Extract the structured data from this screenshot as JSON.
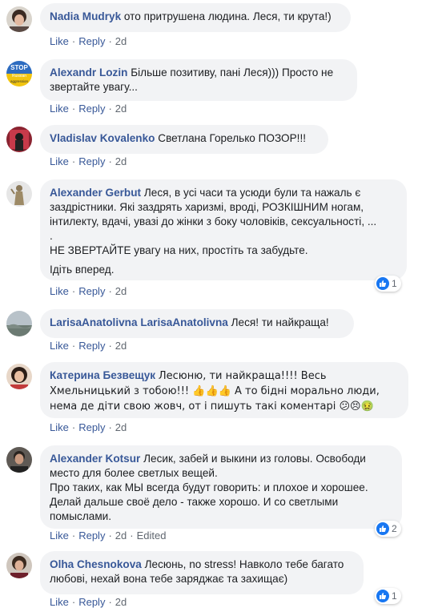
{
  "comments": [
    {
      "author": "Nadia Mudryk",
      "paragraphs": [
        "ото притрушена людина. Леся, ти крута!)"
      ],
      "actions": {
        "like": "Like",
        "reply": "Reply",
        "time": "2d"
      }
    },
    {
      "author": "Alexandr Lozin",
      "paragraphs": [
        "Більше позитиву, пані Леся))) Просто не звертайте увагу..."
      ],
      "avatar_text": {
        "line1": "STOP",
        "line2": "Russian",
        "line3": "aggression"
      },
      "actions": {
        "like": "Like",
        "reply": "Reply",
        "time": "2d"
      }
    },
    {
      "author": "Vladislav Kovalenko",
      "paragraphs": [
        "Светлана Горелько ПОЗОР!!!"
      ],
      "actions": {
        "like": "Like",
        "reply": "Reply",
        "time": "2d"
      }
    },
    {
      "author": "Alexander Gerbut",
      "paragraphs": [
        "Леся, в усі часи та усюди були та нажаль є заздрістники. Які заздрять харизмі, вроді, РОЗКІШНИМ ногам, інтилекту, вдачі, увазі до жінки з боку чоловіків, сексуальності, ...",
        ".",
        "НЕ ЗВЕРТАЙТЕ увагу на них, простіть та забудьте.",
        "Ідіть вперед."
      ],
      "actions": {
        "like": "Like",
        "reply": "Reply",
        "time": "2d"
      },
      "reaction_count": "1"
    },
    {
      "author": "LarisaAnatolivna LarisaAnatolivna",
      "paragraphs": [
        "Леся! ти найкраща!"
      ],
      "actions": {
        "like": "Like",
        "reply": "Reply",
        "time": "2d"
      }
    },
    {
      "author": "Катерина Безвещук",
      "paragraphs": [
        "Лесюню, ти найкраща!!!! Весь Хмельницький з тобою!!! 👍👍👍 А то бідні морально люди, нема де діти свою жовч, от і пишуть такі коментарі 😕😣🤢"
      ],
      "actions": {
        "like": "Like",
        "reply": "Reply",
        "time": "2d"
      }
    },
    {
      "author": "Alexander Kotsur",
      "paragraphs": [
        "Лесик, забей и выкини из головы. Освободи место для более светлых вещей.",
        "Про таких, как МЫ всегда будут говорить: и плохое и хорошее. Делай дальше своё дело - также хорошо. И со светлыми помыслами."
      ],
      "actions": {
        "like": "Like",
        "reply": "Reply",
        "time": "2d",
        "edited": "Edited"
      },
      "reaction_count": "2"
    },
    {
      "author": "Olha Chesnokova",
      "paragraphs": [
        "Лесюнь, no stress! Навколо тебе багато любові, нехай вона тебе заряджає та захищає)"
      ],
      "actions": {
        "like": "Like",
        "reply": "Reply",
        "time": "2d"
      },
      "reaction_count": "1"
    }
  ],
  "colors": {
    "author": "#385898",
    "bubble": "#f2f3f5",
    "meta": "#606770",
    "like_blue": "#1877f2"
  }
}
